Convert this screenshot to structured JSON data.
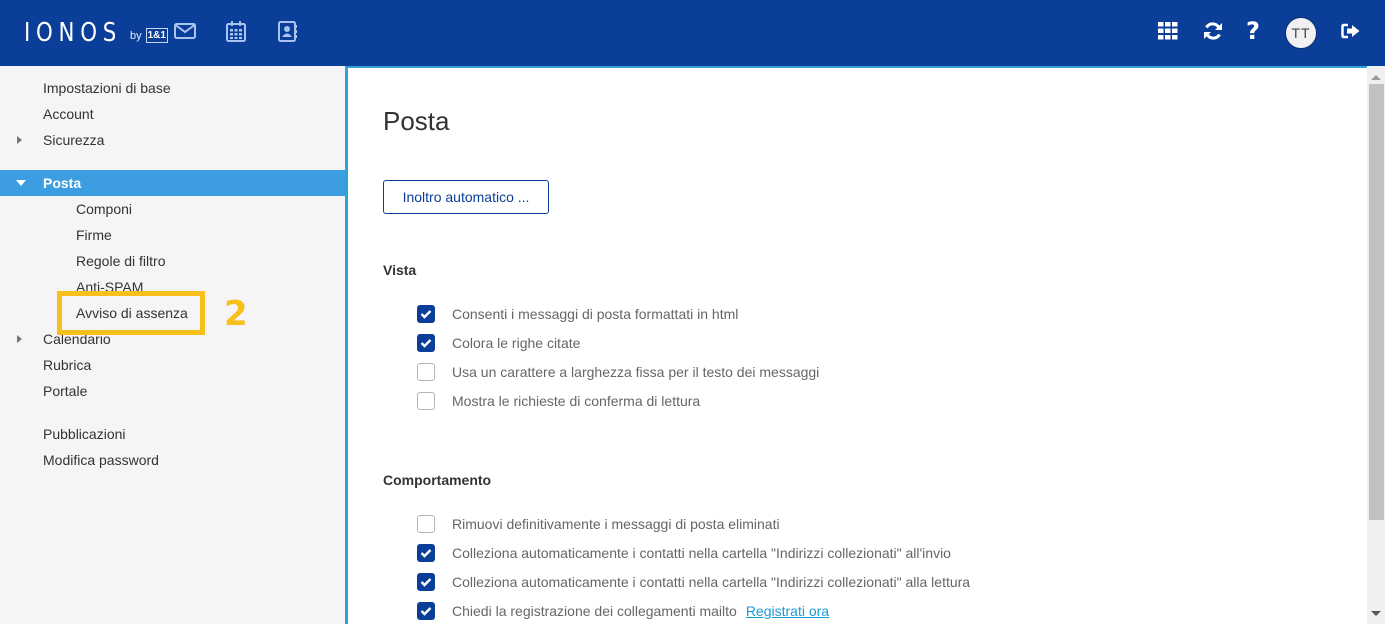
{
  "header": {
    "logo_text": "IONOS",
    "logo_by": "by",
    "logo_badge": "1&1",
    "nav_icons": [
      "mail-icon",
      "calendar-icon",
      "contacts-icon"
    ],
    "right_icons": [
      "apps-grid-icon",
      "refresh-icon",
      "help-icon",
      "logout-icon"
    ],
    "avatar_initials": "TT",
    "colors": {
      "bar": "#0b3e98",
      "accent": "#3c9ee0"
    }
  },
  "sidebar": {
    "items": [
      {
        "label": "Impostazioni di base",
        "level": 0,
        "arrow": "none"
      },
      {
        "label": "Account",
        "level": 0,
        "arrow": "none"
      },
      {
        "label": "Sicurezza",
        "level": 0,
        "arrow": "right"
      },
      {
        "label": "Posta",
        "level": 0,
        "arrow": "down",
        "active": true
      },
      {
        "label": "Componi",
        "level": 1
      },
      {
        "label": "Firme",
        "level": 1
      },
      {
        "label": "Regole di filtro",
        "level": 1
      },
      {
        "label": "Anti-SPAM",
        "level": 1
      },
      {
        "label": "Avviso di assenza",
        "level": 1,
        "highlighted": true
      },
      {
        "label": "Calendario",
        "level": 0,
        "arrow": "right"
      },
      {
        "label": "Rubrica",
        "level": 0,
        "arrow": "none"
      },
      {
        "label": "Portale",
        "level": 0,
        "arrow": "none"
      },
      {
        "label": "Pubblicazioni",
        "level": 0,
        "arrow": "none"
      },
      {
        "label": "Modifica password",
        "level": 0,
        "arrow": "none"
      }
    ],
    "annotation_number": "2",
    "annotation_color": "#f8c01a"
  },
  "main": {
    "title": "Posta",
    "auto_forward_button": "Inoltro automatico ...",
    "sections": [
      {
        "title": "Vista",
        "options": [
          {
            "label": "Consenti i messaggi di posta formattati in html",
            "checked": true
          },
          {
            "label": "Colora le righe citate",
            "checked": true
          },
          {
            "label": "Usa un carattere a larghezza fissa per il testo dei messaggi",
            "checked": false
          },
          {
            "label": "Mostra le richieste di conferma di lettura",
            "checked": false
          }
        ]
      },
      {
        "title": "Comportamento",
        "options": [
          {
            "label": "Rimuovi definitivamente i messaggi di posta eliminati",
            "checked": false
          },
          {
            "label": "Colleziona automaticamente i contatti nella cartella \"Indirizzi collezionati\" all'invio",
            "checked": true
          },
          {
            "label": "Colleziona automaticamente i contatti nella cartella \"Indirizzi collezionati\" alla lettura",
            "checked": true
          },
          {
            "label": "Chiedi la registrazione dei collegamenti mailto",
            "checked": true,
            "link": "Registrati ora"
          }
        ]
      }
    ]
  }
}
